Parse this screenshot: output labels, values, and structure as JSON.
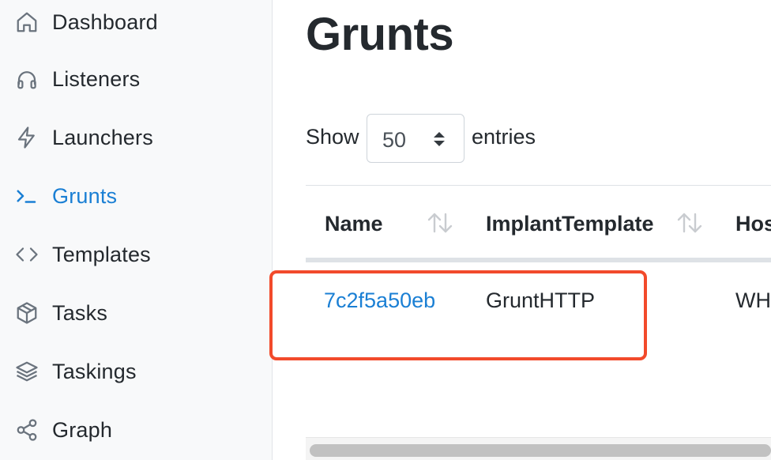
{
  "sidebar": {
    "items": [
      {
        "label": "Dashboard",
        "icon": "home-icon",
        "active": false
      },
      {
        "label": "Listeners",
        "icon": "headphones-icon",
        "active": false
      },
      {
        "label": "Launchers",
        "icon": "lightning-icon",
        "active": false
      },
      {
        "label": "Grunts",
        "icon": "terminal-icon",
        "active": true
      },
      {
        "label": "Templates",
        "icon": "code-icon",
        "active": false
      },
      {
        "label": "Tasks",
        "icon": "package-icon",
        "active": false
      },
      {
        "label": "Taskings",
        "icon": "layers-icon",
        "active": false
      },
      {
        "label": "Graph",
        "icon": "share-icon",
        "active": false
      }
    ]
  },
  "main": {
    "title": "Grunts",
    "length_menu": {
      "prefix": "Show",
      "value": "50",
      "suffix": "entries"
    },
    "table": {
      "columns": [
        "Name",
        "ImplantTemplate",
        "Hos"
      ],
      "rows": [
        {
          "name": "7c2f5a50eb",
          "implant_template": "GruntHTTP",
          "hostname": "WH"
        }
      ]
    }
  },
  "colors": {
    "accent": "#1a7fd4",
    "highlight": "#f24a2b",
    "sidebar_bg": "#f8f9fa"
  }
}
